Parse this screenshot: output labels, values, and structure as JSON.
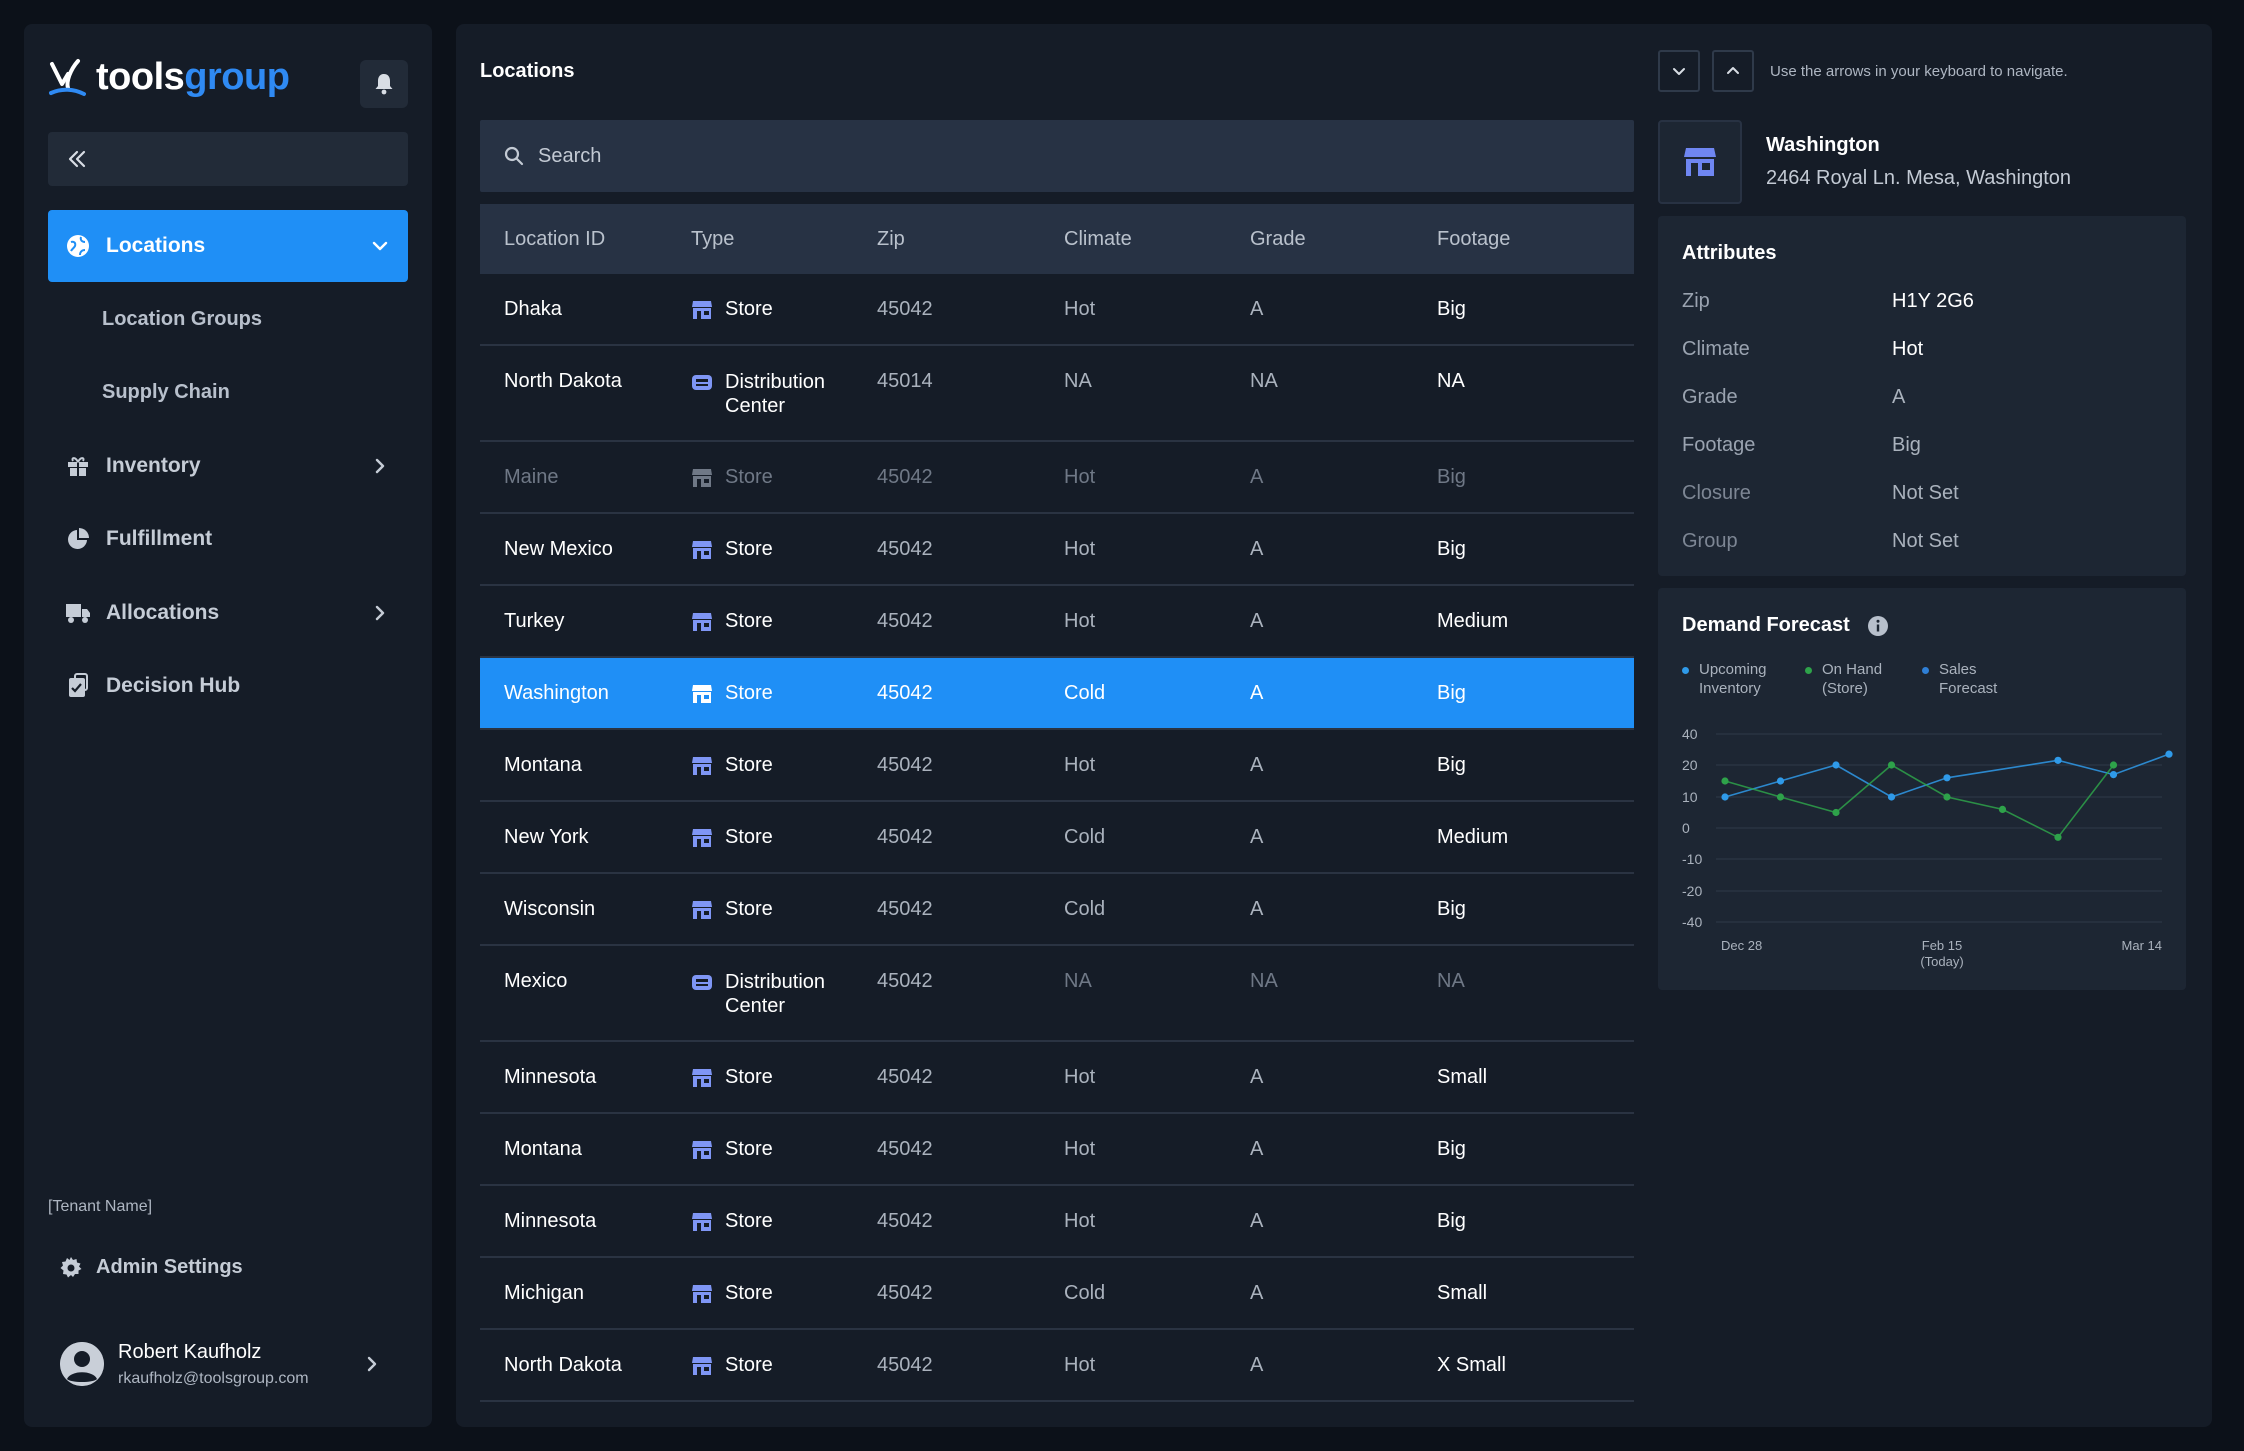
{
  "brand": {
    "logo_text_a": "tools",
    "logo_text_b": "group",
    "accent": "#1f8ff6"
  },
  "sidebar": {
    "items": [
      {
        "label": "Locations",
        "icon": "globe-icon",
        "active": true,
        "expanded": true
      },
      {
        "label": "Location Groups",
        "sub": true
      },
      {
        "label": "Supply Chain",
        "sub": true
      },
      {
        "label": "Inventory",
        "icon": "gift-icon",
        "has_children": true
      },
      {
        "label": "Fulfillment",
        "icon": "pie-chart-icon"
      },
      {
        "label": "Allocations",
        "icon": "truck-icon",
        "has_children": true
      },
      {
        "label": "Decision Hub",
        "icon": "checklist-icon"
      }
    ],
    "tenant": "[Tenant Name]",
    "admin_label": "Admin Settings",
    "user": {
      "name": "Robert Kaufholz",
      "email": "rkaufholz@toolsgroup.com"
    }
  },
  "main": {
    "title": "Locations",
    "search_placeholder": "Search",
    "columns": [
      "Location ID",
      "Type",
      "Zip",
      "Climate",
      "Grade",
      "Footage"
    ],
    "rows": [
      {
        "id": "Dhaka",
        "type": "Store",
        "zip": "45042",
        "climate": "Hot",
        "grade": "A",
        "footage": "Big"
      },
      {
        "id": "North Dakota",
        "type": "Distribution Center",
        "zip": "45014",
        "climate": "NA",
        "grade": "NA",
        "footage": "NA"
      },
      {
        "id": "Maine",
        "type": "Store",
        "zip": "45042",
        "climate": "Hot",
        "grade": "A",
        "footage": "Big"
      },
      {
        "id": "New Mexico",
        "type": "Store",
        "zip": "45042",
        "climate": "Hot",
        "grade": "A",
        "footage": "Big"
      },
      {
        "id": "Turkey",
        "type": "Store",
        "zip": "45042",
        "climate": "Hot",
        "grade": "A",
        "footage": "Medium"
      },
      {
        "id": "Washington",
        "type": "Store",
        "zip": "45042",
        "climate": "Cold",
        "grade": "A",
        "footage": "Big"
      },
      {
        "id": "Montana",
        "type": "Store",
        "zip": "45042",
        "climate": "Hot",
        "grade": "A",
        "footage": "Big"
      },
      {
        "id": "New York",
        "type": "Store",
        "zip": "45042",
        "climate": "Cold",
        "grade": "A",
        "footage": "Medium"
      },
      {
        "id": "Wisconsin",
        "type": "Store",
        "zip": "45042",
        "climate": "Cold",
        "grade": "A",
        "footage": "Big"
      },
      {
        "id": "Mexico",
        "type": "Distribution Center",
        "zip": "45042",
        "climate": "NA",
        "grade": "NA",
        "footage": "NA"
      },
      {
        "id": "Minnesota",
        "type": "Store",
        "zip": "45042",
        "climate": "Hot",
        "grade": "A",
        "footage": "Small"
      },
      {
        "id": "Montana",
        "type": "Store",
        "zip": "45042",
        "climate": "Hot",
        "grade": "A",
        "footage": "Big"
      },
      {
        "id": "Minnesota",
        "type": "Store",
        "zip": "45042",
        "climate": "Hot",
        "grade": "A",
        "footage": "Big"
      },
      {
        "id": "Michigan",
        "type": "Store",
        "zip": "45042",
        "climate": "Cold",
        "grade": "A",
        "footage": "Small"
      },
      {
        "id": "North Dakota",
        "type": "Store",
        "zip": "45042",
        "climate": "Hot",
        "grade": "A",
        "footage": "X Small"
      }
    ],
    "selected_row": "Washington",
    "disabled_row": "Maine"
  },
  "detail": {
    "nav_hint": "Use the arrows in your keyboard to navigate.",
    "name": "Washington",
    "address": "2464 Royal Ln. Mesa, Washington",
    "attributes_title": "Attributes",
    "attributes": [
      {
        "label": "Zip",
        "value": "H1Y 2G6"
      },
      {
        "label": "Climate",
        "value": "Hot"
      },
      {
        "label": "Grade",
        "value": "A"
      },
      {
        "label": "Footage",
        "value": "Big"
      },
      {
        "label": "Closure",
        "value": "Not Set"
      },
      {
        "label": "Group",
        "value": "Not Set"
      }
    ],
    "forecast_title": "Demand Forecast"
  },
  "chart_data": {
    "type": "line",
    "title": "Demand Forecast",
    "y_ticks": [
      40,
      20,
      10,
      0,
      -10,
      -20,
      -40
    ],
    "x_tick_labels": [
      "Dec 28",
      "Feb 15",
      "(Today)",
      "Mar 14"
    ],
    "legend": [
      "Upcoming Inventory",
      "On Hand (Store)",
      "Sales Forecast"
    ],
    "series": [
      {
        "name": "Upcoming Inventory",
        "color": "#2f9ae9",
        "values": [
          10,
          15,
          20,
          10,
          16,
          null,
          23,
          17,
          27
        ]
      },
      {
        "name": "On Hand (Store)",
        "color": "#2ea24a",
        "values": [
          15,
          10,
          5,
          20,
          10,
          6,
          -3,
          20
        ]
      },
      {
        "name": "Sales Forecast",
        "color": "#2f7fd6",
        "values": []
      }
    ]
  }
}
